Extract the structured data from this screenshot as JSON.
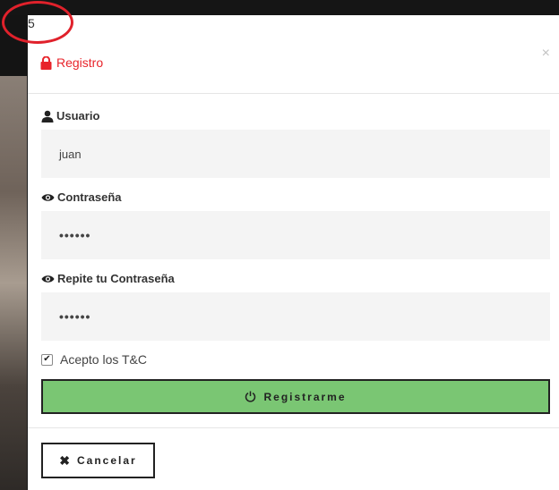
{
  "overlay": {
    "number": "5"
  },
  "modal": {
    "title": "Registro",
    "close_symbol": "×",
    "fields": [
      {
        "label": "Usuario",
        "icon": "user-icon",
        "value": "juan"
      },
      {
        "label": "Contraseña",
        "icon": "eye-icon",
        "value": "••••••"
      },
      {
        "label": "Repite tu Contraseña",
        "icon": "eye-icon",
        "value": "••••••"
      }
    ],
    "terms": {
      "label": "Acepto los T&C",
      "checked": true
    },
    "submit_label": "Registrarme",
    "cancel_label": "Cancelar",
    "cancel_symbol": "✖"
  },
  "colors": {
    "accent_red": "#e8242b",
    "submit_green": "#7ac673"
  }
}
